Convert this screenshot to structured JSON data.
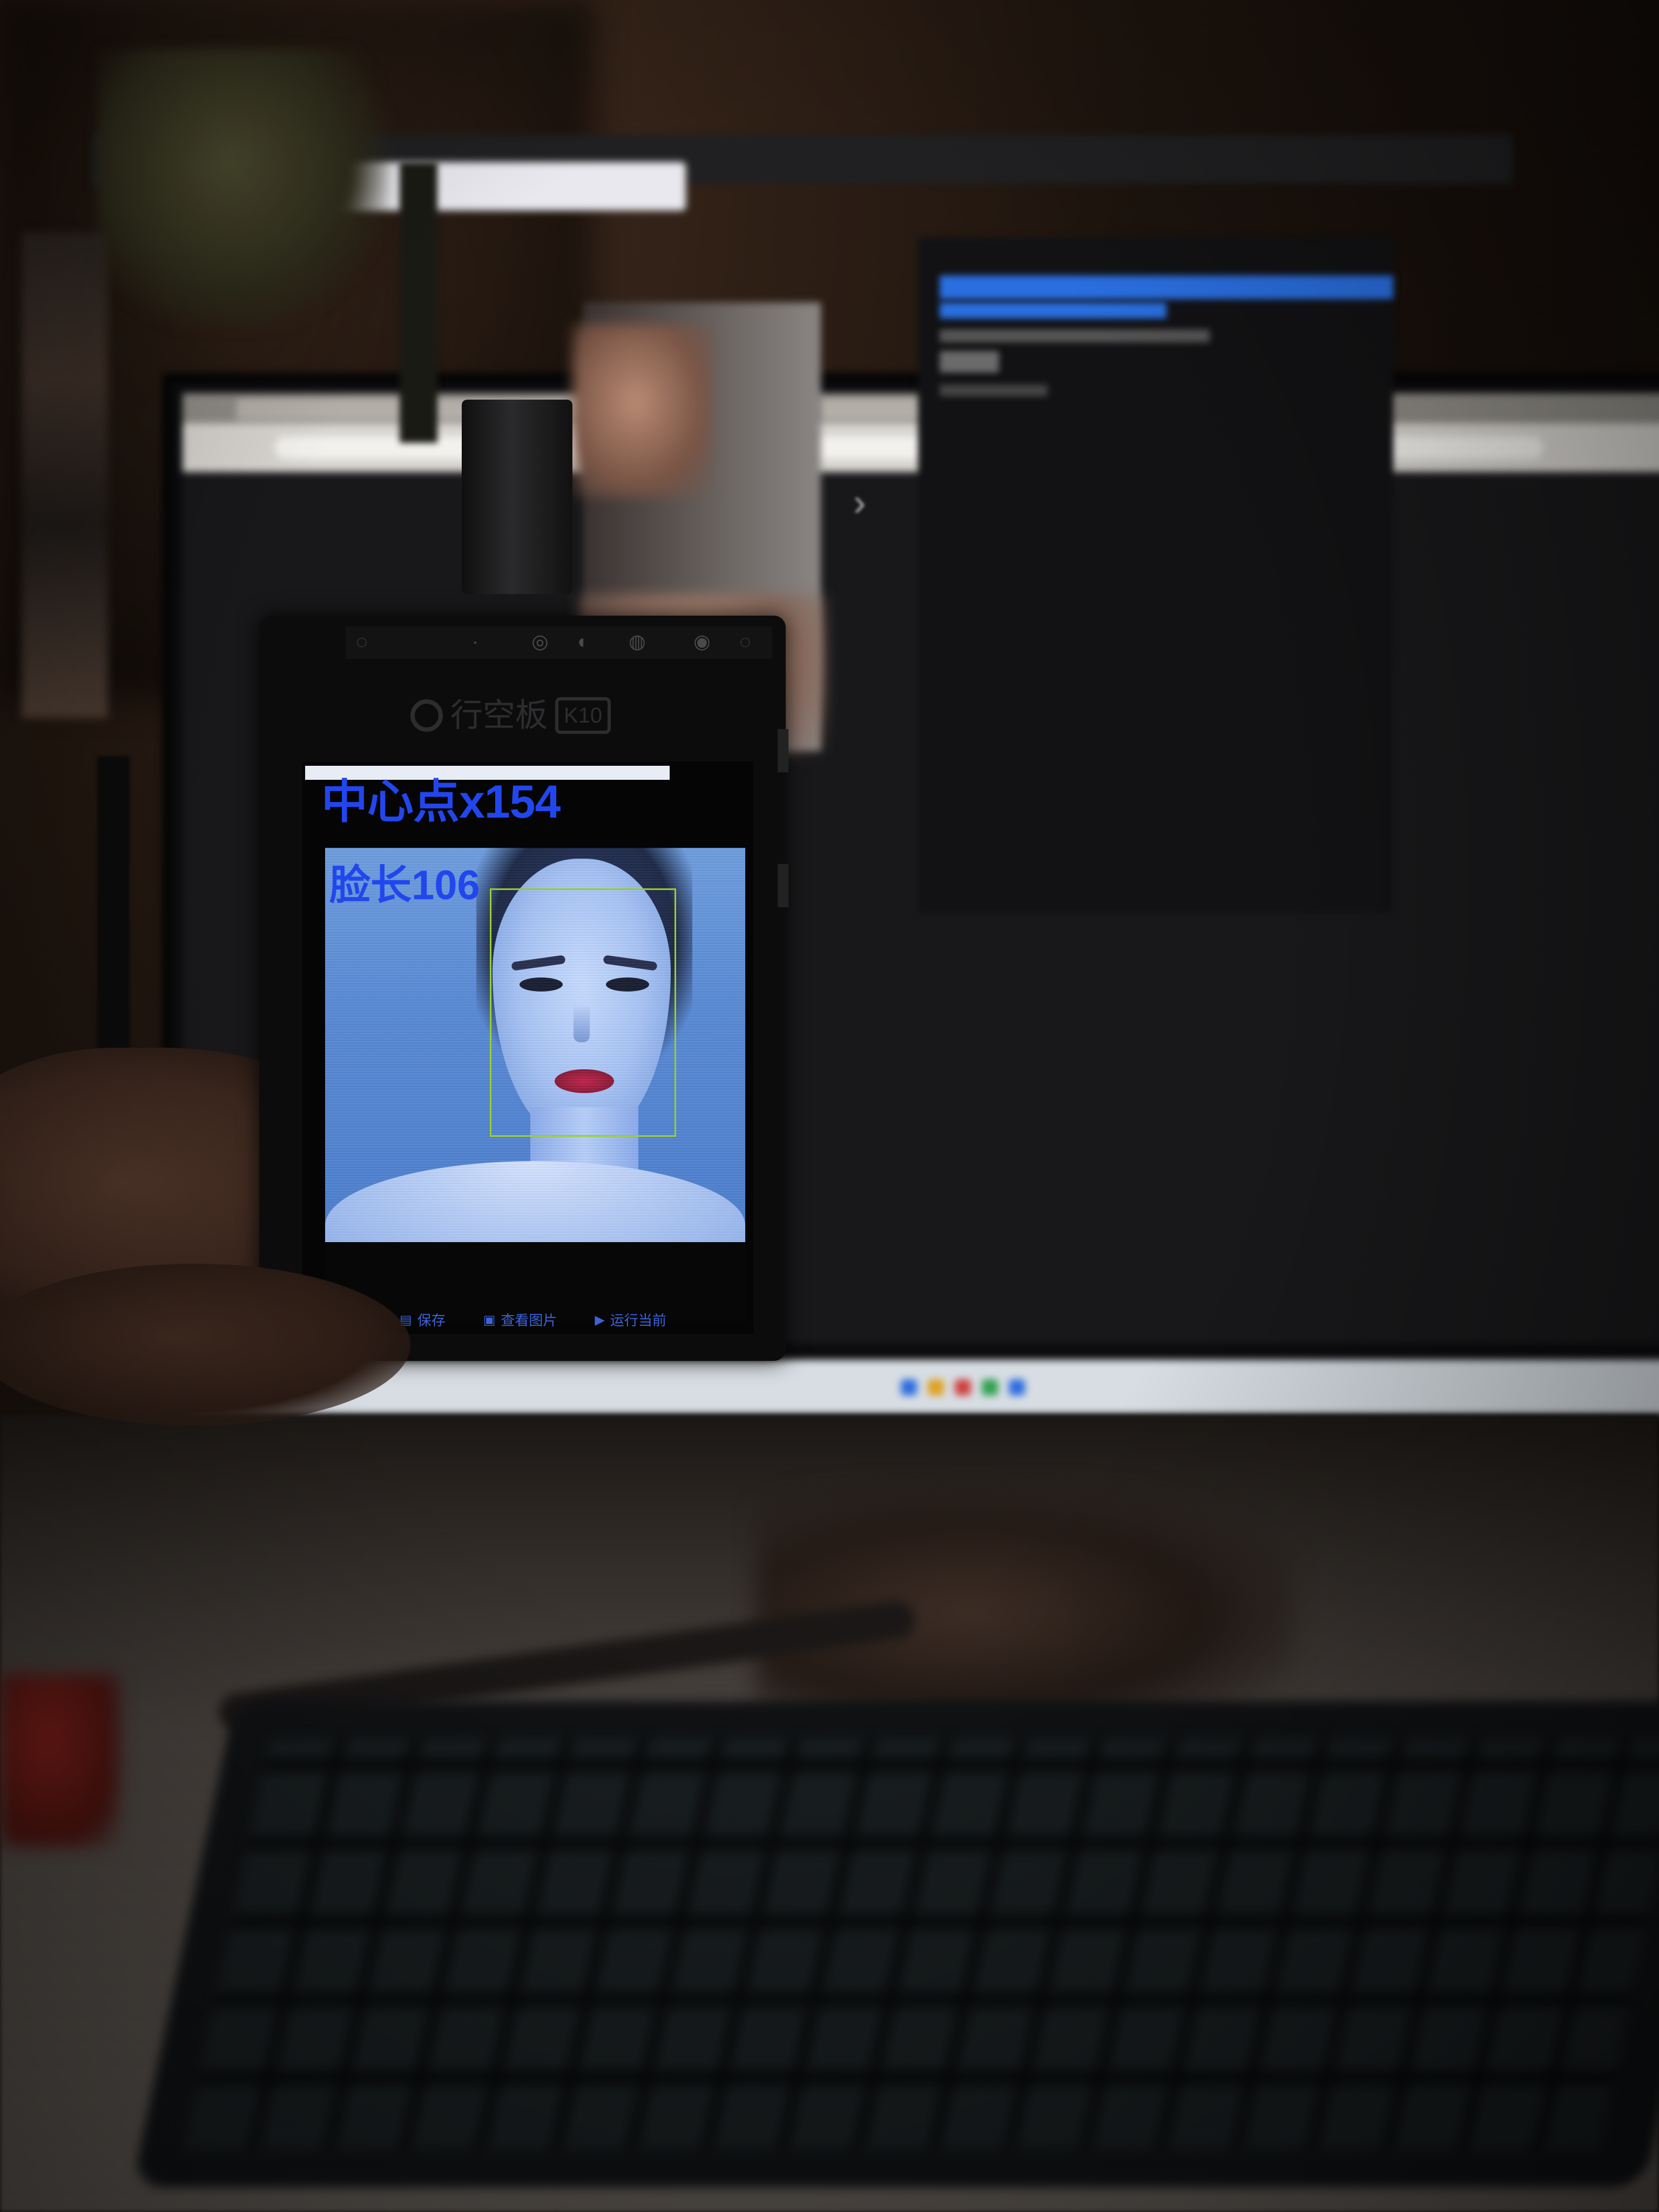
{
  "board": {
    "logo_text": "行空板",
    "logo_badge": "K10"
  },
  "lcd": {
    "center_point_label": "中心点x154",
    "face_length_label": "脸长106",
    "toolbar": [
      {
        "icon": "save-icon",
        "label": "保存"
      },
      {
        "icon": "image-icon",
        "label": "查看图片"
      },
      {
        "icon": "play-icon",
        "label": "运行当前"
      }
    ]
  },
  "colors": {
    "lcd_text": "#2246ee",
    "face_box": "#9bd22a",
    "camera_tint": "#5a8bd6"
  }
}
